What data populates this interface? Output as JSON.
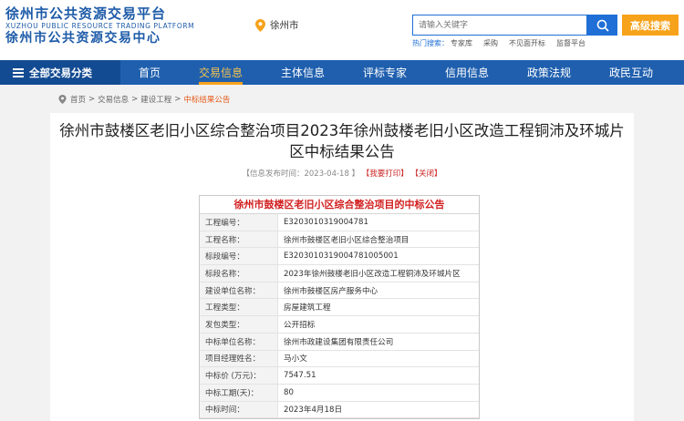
{
  "header": {
    "logo_cn": "徐州市公共资源交易平台",
    "logo_en": "XUZHOU PUBLIC RESOURCE TRADING PLATFORM",
    "logo_sub": "徐州市公共资源交易中心",
    "city": "徐州市",
    "search_placeholder": "请输入关键字",
    "advanced_search_label": "高级搜索",
    "hot_label": "热门搜索：",
    "hot_items": [
      "专家库",
      "采购",
      "不见面开标",
      "监督平台"
    ]
  },
  "colors": {
    "brand": "#1f5fae",
    "accent": "#f7a21b",
    "alert": "#d21f1f"
  },
  "nav": {
    "all_label": "全部交易分类",
    "items": [
      "首页",
      "交易信息",
      "主体信息",
      "评标专家",
      "信用信息",
      "政策法规",
      "政民互动"
    ],
    "active_index": 1
  },
  "breadcrumb": [
    "首页",
    "交易信息",
    "建设工程",
    "中标结果公告"
  ],
  "article": {
    "title": "徐州市鼓楼区老旧小区综合整治项目2023年徐州鼓楼老旧小区改造工程铜沛及环城片区中标结果公告",
    "publish_label": "【信息发布时间：2023-04-18 】",
    "print_label": "【我要打印】",
    "close_label": "【关闭】"
  },
  "notice": {
    "title": "徐州市鼓楼区老旧小区综合整治项目的中标公告",
    "rows": [
      {
        "key": "工程编号：",
        "value": "E3203010319004781"
      },
      {
        "key": "工程名称：",
        "value": "徐州市鼓楼区老旧小区综合整治项目"
      },
      {
        "key": "标段编号：",
        "value": "E3203010319004781005001"
      },
      {
        "key": "标段名称：",
        "value": "2023年徐州鼓楼老旧小区改造工程铜沛及环城片区"
      },
      {
        "key": "建设单位名称：",
        "value": "徐州市鼓楼区房产服务中心"
      },
      {
        "key": "工程类型：",
        "value": "房屋建筑工程"
      },
      {
        "key": "发包类型：",
        "value": "公开招标"
      },
      {
        "key": "中标单位名称：",
        "value": "徐州市政建设集团有限责任公司"
      },
      {
        "key": "项目经理姓名：",
        "value": "马小文"
      },
      {
        "key": "中标价 (万元)：",
        "value": "7547.51"
      },
      {
        "key": "中标工期(天)：",
        "value": "80"
      },
      {
        "key": "中标时间：",
        "value": "2023年4月18日"
      }
    ]
  }
}
